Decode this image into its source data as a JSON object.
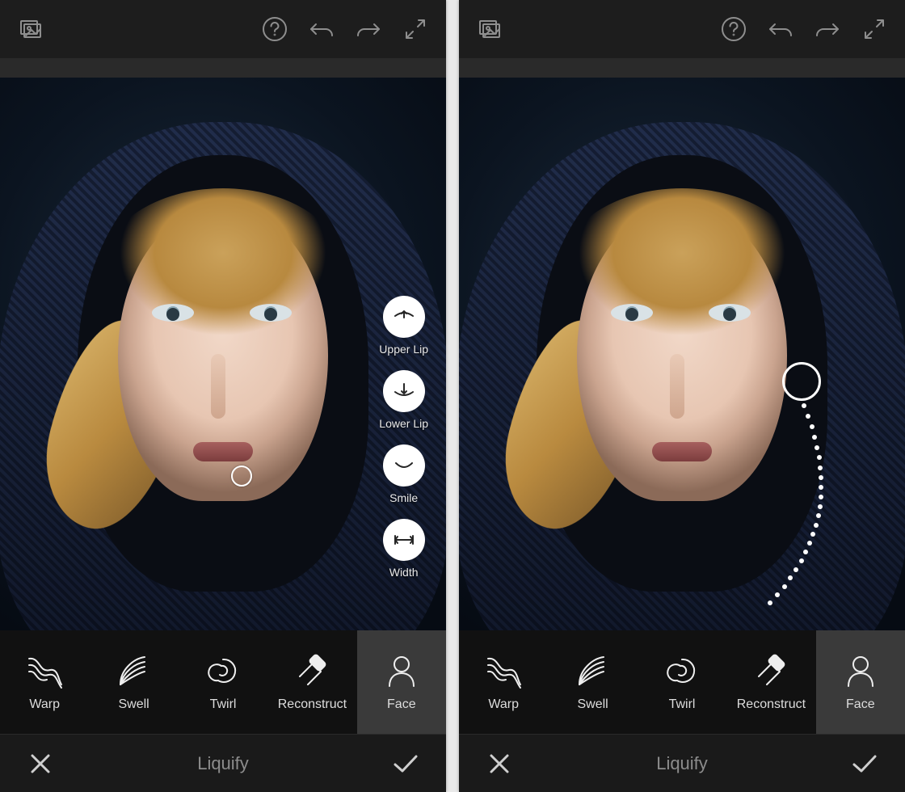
{
  "editorTitle": "Liquify",
  "tools": {
    "warp": {
      "label": "Warp"
    },
    "swell": {
      "label": "Swell"
    },
    "twirl": {
      "label": "Twirl"
    },
    "reconstruct": {
      "label": "Reconstruct"
    },
    "face": {
      "label": "Face"
    }
  },
  "selectedTool": "face",
  "faceOptions": {
    "upperLip": {
      "label": "Upper Lip"
    },
    "lowerLip": {
      "label": "Lower Lip"
    },
    "smile": {
      "label": "Smile"
    },
    "width": {
      "label": "Width"
    }
  },
  "topbarIcons": {
    "compare": "compare-original-icon",
    "help": "help-icon",
    "undo": "undo-icon",
    "redo": "redo-icon",
    "fullscreen": "fullscreen-icon"
  },
  "bottomActions": {
    "cancel": "cancel-icon",
    "accept": "accept-icon"
  }
}
